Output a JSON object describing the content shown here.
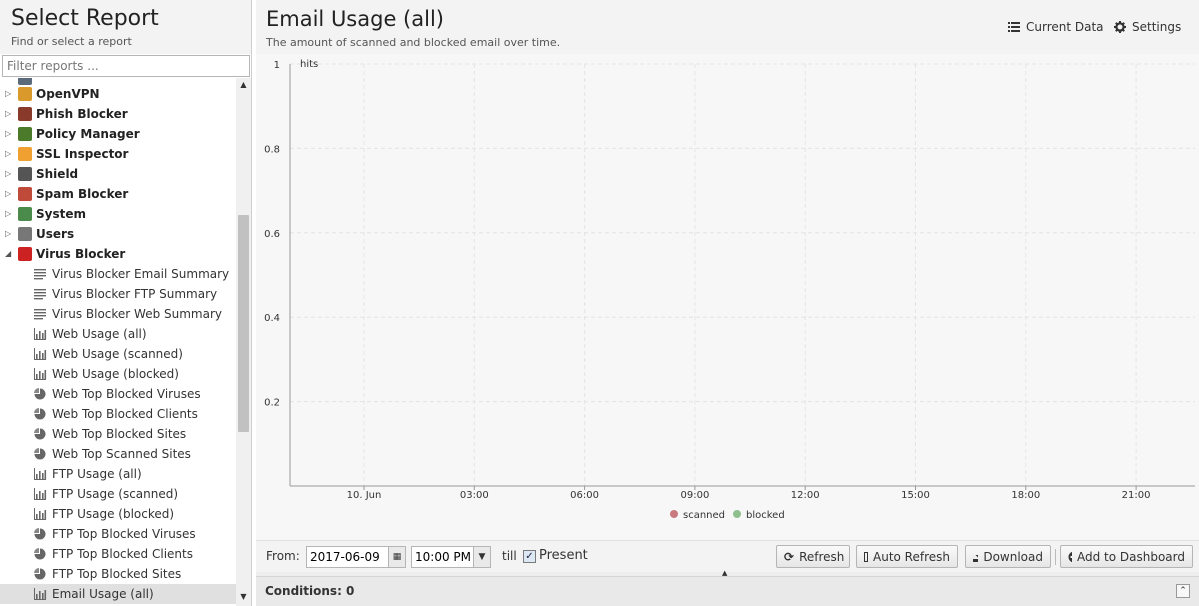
{
  "left_panel": {
    "title": "Select Report",
    "subtitle": "Find or select a report",
    "filter_placeholder": "Filter reports ..."
  },
  "tree": {
    "categories": [
      {
        "label": "OpenVPN",
        "icon": "openvpn-icon",
        "color": "#d99a2b",
        "expanded": false
      },
      {
        "label": "Phish Blocker",
        "icon": "phish-blocker-icon",
        "color": "#8a3a2a",
        "expanded": false
      },
      {
        "label": "Policy Manager",
        "icon": "policy-manager-icon",
        "color": "#4a7a2a",
        "expanded": false
      },
      {
        "label": "SSL Inspector",
        "icon": "ssl-inspector-icon",
        "color": "#f0a030",
        "expanded": false
      },
      {
        "label": "Shield",
        "icon": "shield-icon",
        "color": "#555555",
        "expanded": false
      },
      {
        "label": "Spam Blocker",
        "icon": "spam-blocker-icon",
        "color": "#c04a3a",
        "expanded": false
      },
      {
        "label": "System",
        "icon": "system-icon",
        "color": "#4a8a4a",
        "expanded": false
      },
      {
        "label": "Users",
        "icon": "users-icon",
        "color": "#777777",
        "expanded": false
      },
      {
        "label": "Virus Blocker",
        "icon": "virus-blocker-icon",
        "color": "#cc2222",
        "expanded": true
      }
    ],
    "reports": [
      {
        "label": "Virus Blocker Email Summary",
        "icon": "text-report-icon"
      },
      {
        "label": "Virus Blocker FTP Summary",
        "icon": "text-report-icon"
      },
      {
        "label": "Virus Blocker Web Summary",
        "icon": "text-report-icon"
      },
      {
        "label": "Web Usage (all)",
        "icon": "bar-chart-icon"
      },
      {
        "label": "Web Usage (scanned)",
        "icon": "bar-chart-icon"
      },
      {
        "label": "Web Usage (blocked)",
        "icon": "bar-chart-icon"
      },
      {
        "label": "Web Top Blocked Viruses",
        "icon": "pie-chart-icon"
      },
      {
        "label": "Web Top Blocked Clients",
        "icon": "pie-chart-icon"
      },
      {
        "label": "Web Top Blocked Sites",
        "icon": "pie-chart-icon"
      },
      {
        "label": "Web Top Scanned Sites",
        "icon": "pie-chart-icon"
      },
      {
        "label": "FTP Usage (all)",
        "icon": "bar-chart-icon"
      },
      {
        "label": "FTP Usage (scanned)",
        "icon": "bar-chart-icon"
      },
      {
        "label": "FTP Usage (blocked)",
        "icon": "bar-chart-icon"
      },
      {
        "label": "FTP Top Blocked Viruses",
        "icon": "pie-chart-icon"
      },
      {
        "label": "FTP Top Blocked Clients",
        "icon": "pie-chart-icon"
      },
      {
        "label": "FTP Top Blocked Sites",
        "icon": "pie-chart-icon"
      },
      {
        "label": "Email Usage (all)",
        "icon": "bar-chart-icon",
        "selected": true
      }
    ]
  },
  "report": {
    "title": "Email Usage (all)",
    "description": "The amount of scanned and blocked email over time.",
    "current_data_label": "Current Data",
    "settings_label": "Settings"
  },
  "chart_data": {
    "type": "line",
    "ylabel": "hits",
    "ylim": [
      0,
      1
    ],
    "y_ticks": [
      0.2,
      0.4,
      0.6,
      0.8,
      1
    ],
    "x_ticks": [
      "10. Jun",
      "03:00",
      "06:00",
      "09:00",
      "12:00",
      "15:00",
      "18:00",
      "21:00"
    ],
    "series": [
      {
        "name": "scanned",
        "color": "#c97a7e",
        "values": []
      },
      {
        "name": "blocked",
        "color": "#8fbf8f",
        "values": []
      }
    ],
    "grid": true,
    "legend": "bottom-center"
  },
  "toolbar": {
    "from_label": "From:",
    "date_value": "2017-06-09",
    "time_value": "10:00 PM",
    "till_label": "till",
    "present_label": "Present",
    "present_checked": true,
    "refresh_label": "Refresh",
    "auto_refresh_label": "Auto Refresh",
    "download_label": "Download",
    "add_dashboard_label": "Add to Dashboard"
  },
  "conditions": {
    "label": "Conditions: 0"
  }
}
